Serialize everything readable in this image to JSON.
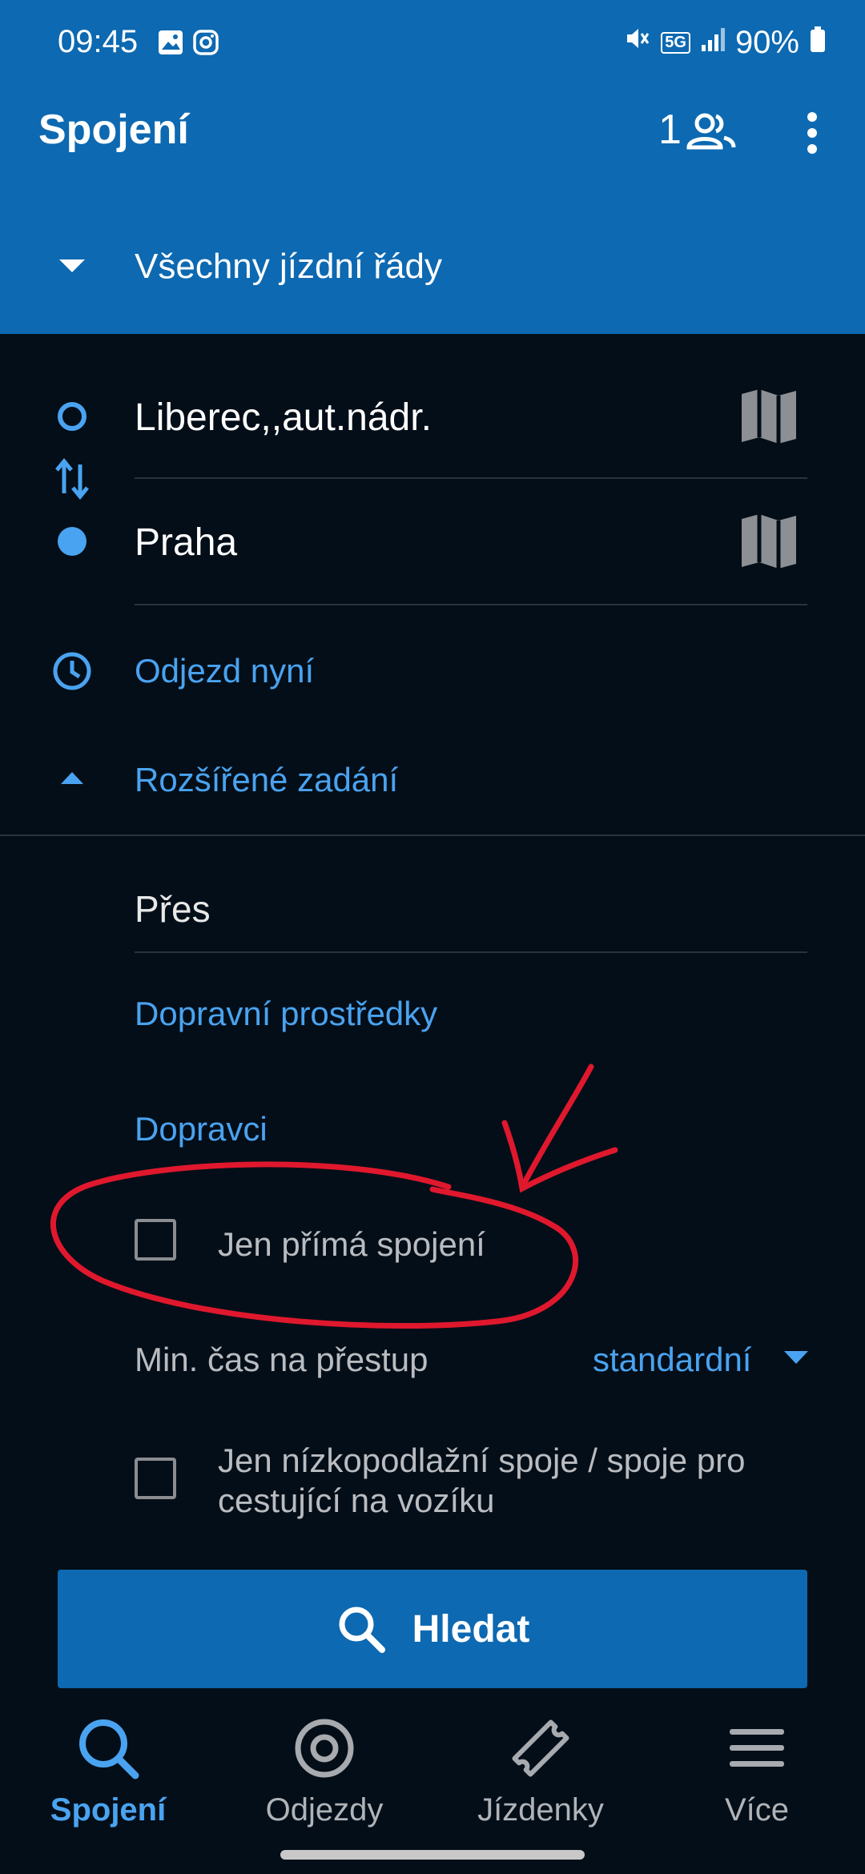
{
  "status_bar": {
    "time": "09:45",
    "battery": "90%",
    "network": "5G"
  },
  "app_bar": {
    "title": "Spojení",
    "passenger_count": "1"
  },
  "timetable_selector": {
    "label": "Všechny jízdní řády"
  },
  "route": {
    "from": "Liberec,,aut.nádr.",
    "to": "Praha"
  },
  "departure": {
    "label": "Odjezd nyní"
  },
  "advanced": {
    "toggle_label": "Rozšířené zadání",
    "via_placeholder": "Přes",
    "transport_means": "Dopravní prostředky",
    "carriers": "Dopravci",
    "direct_only": {
      "label": "Jen přímá spojení",
      "checked": false
    },
    "min_transfer": {
      "label": "Min. čas na přestup",
      "value": "standardní"
    },
    "low_floor": {
      "label_line1": "Jen nízkopodlažní spoje / spoje pro",
      "label_line2": "cestující na vozíku",
      "checked": false
    }
  },
  "search_button": {
    "label": "Hledat"
  },
  "bottom_nav": [
    {
      "label": "Spojení",
      "icon": "search-icon",
      "active": true
    },
    {
      "label": "Odjezdy",
      "icon": "target-icon",
      "active": false
    },
    {
      "label": "Jízdenky",
      "icon": "ticket-icon",
      "active": false
    },
    {
      "label": "Více",
      "icon": "menu-icon",
      "active": false
    }
  ],
  "colors": {
    "primary": "#0d69b1",
    "accent": "#4aa3f0",
    "background": "#040e18",
    "annotation": "#e0182d"
  }
}
